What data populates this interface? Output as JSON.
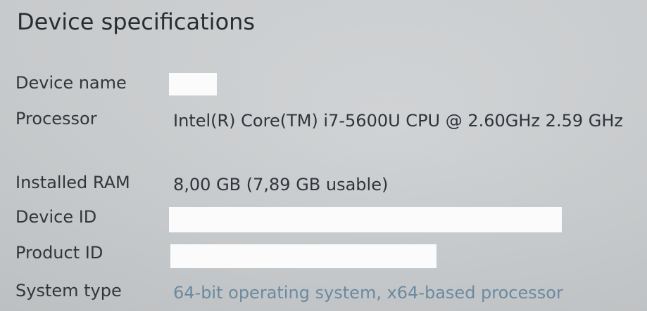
{
  "section": {
    "title": "Device specifications"
  },
  "specs": {
    "device_name": {
      "label": "Device name",
      "value": ""
    },
    "processor": {
      "label": "Processor",
      "value": "Intel(R) Core(TM) i7-5600U CPU @ 2.60GHz   2.59 GHz"
    },
    "installed_ram": {
      "label": "Installed RAM",
      "value": "8,00 GB (7,89 GB usable)"
    },
    "device_id": {
      "label": "Device ID",
      "value": ""
    },
    "product_id": {
      "label": "Product ID",
      "value": ""
    },
    "system_type": {
      "label": "System type",
      "value": "64-bit operating system, x64-based processor"
    }
  },
  "colors": {
    "background": "#cbced0",
    "text": "#30343a",
    "redaction": "#fbfbfb",
    "faded_text": "#6b8aa0"
  }
}
